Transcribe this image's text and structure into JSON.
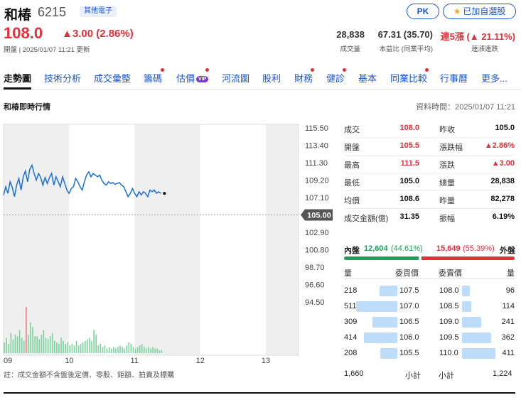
{
  "header": {
    "name": "和椿",
    "code": "6215",
    "category": "其他電子",
    "pk_label": "PK",
    "watch_label": "已加自選股"
  },
  "quote": {
    "price": "108.0",
    "change": "▲3.00 (2.86%)",
    "status": "開盤 | 2025/01/07 11:21 更新",
    "volume": "28,838",
    "volume_label": "成交量",
    "pe": "67.31 (35.70)",
    "pe_label": "本益比 (同業平均)",
    "streak": "連5漲 (▲ 21.11%)",
    "streak_label": "連漲連跌"
  },
  "tabs": [
    {
      "label": "走勢圖",
      "dot": false
    },
    {
      "label": "技術分析",
      "dot": false
    },
    {
      "label": "成交彙整",
      "dot": false
    },
    {
      "label": "籌碼",
      "dot": true
    },
    {
      "label": "估價",
      "dot": true,
      "vip": "VIP"
    },
    {
      "label": "河流圖",
      "dot": false
    },
    {
      "label": "股利",
      "dot": false
    },
    {
      "label": "財務",
      "dot": true
    },
    {
      "label": "健診",
      "dot": true
    },
    {
      "label": "基本",
      "dot": false
    },
    {
      "label": "同業比較",
      "dot": true
    },
    {
      "label": "行事曆",
      "dot": false
    },
    {
      "label": "更多...",
      "dot": false
    }
  ],
  "section": {
    "title": "和椿即時行情",
    "data_time": "資料時間：2025/01/07 11:21"
  },
  "quote_table": [
    {
      "l1": "成交",
      "v1": "108.0",
      "c1": "up",
      "l2": "昨收",
      "v2": "105.0",
      "c2": "flat"
    },
    {
      "l1": "開盤",
      "v1": "105.5",
      "c1": "up",
      "l2": "漲跌幅",
      "v2": "▲2.86%",
      "c2": "up"
    },
    {
      "l1": "最高",
      "v1": "111.5",
      "c1": "up",
      "l2": "漲跌",
      "v2": "▲3.00",
      "c2": "up"
    },
    {
      "l1": "最低",
      "v1": "105.0",
      "c1": "flat",
      "l2": "總量",
      "v2": "28,838",
      "c2": "flat"
    },
    {
      "l1": "均價",
      "v1": "108.6",
      "c1": "flat",
      "l2": "昨量",
      "v2": "82,278",
      "c2": "flat"
    },
    {
      "l1": "成交金額(億)",
      "v1": "31.35",
      "c1": "flat",
      "l2": "振幅",
      "v2": "6.19%",
      "c2": "flat"
    }
  ],
  "order_flow": {
    "inner_label": "內盤",
    "inner_value": "12,604",
    "inner_pct": "(44.61%)",
    "outer_value": "15,649",
    "outer_pct": "(55.39%)",
    "outer_label": "外盤",
    "inner_fraction": 0.4461
  },
  "order_book": {
    "col_bid_qty": "量",
    "col_bid_price": "委買價",
    "col_ask_price": "委賣價",
    "col_ask_qty": "量",
    "bids": [
      {
        "qty": "218",
        "price": "107.5",
        "q": 218
      },
      {
        "qty": "511",
        "price": "107.0",
        "q": 511
      },
      {
        "qty": "309",
        "price": "106.5",
        "q": 309
      },
      {
        "qty": "414",
        "price": "106.0",
        "q": 414
      },
      {
        "qty": "208",
        "price": "105.5",
        "q": 208
      }
    ],
    "asks": [
      {
        "qty": "96",
        "price": "108.0",
        "q": 96
      },
      {
        "qty": "114",
        "price": "108.5",
        "q": 114
      },
      {
        "qty": "241",
        "price": "109.0",
        "q": 241
      },
      {
        "qty": "362",
        "price": "109.5",
        "q": 362
      },
      {
        "qty": "411",
        "price": "110.0",
        "q": 411
      }
    ],
    "bid_total": "1,660",
    "subtotal_label": "小計",
    "ask_total": "1,224"
  },
  "note": "註：成交金額不含盤後定價、零股、鉅額、拍賣及標購",
  "chart_data": {
    "type": "line",
    "y_ticks": [
      "115.50",
      "113.40",
      "111.30",
      "109.20",
      "107.10",
      "105.00",
      "102.90",
      "100.80",
      "98.70",
      "96.60",
      "94.50"
    ],
    "x_ticks": [
      "09",
      "10",
      "11",
      "12",
      "13"
    ],
    "ref_price": 105.0,
    "ylim": [
      94.5,
      115.5
    ],
    "x_range_minutes": [
      0,
      270
    ],
    "colors": {
      "line": "#1a6fd6",
      "volume": "#7ad39c",
      "volume_up": "#e77b7b",
      "ref": "#999999"
    },
    "series": [
      {
        "values": [
          [
            0,
            107.4
          ],
          [
            2,
            108.4
          ],
          [
            4,
            107.6
          ],
          [
            6,
            109.0
          ],
          [
            8,
            108.3
          ],
          [
            10,
            107.2
          ],
          [
            12,
            108.6
          ],
          [
            14,
            109.4
          ],
          [
            16,
            108.0
          ],
          [
            18,
            109.6
          ],
          [
            20,
            110.3
          ],
          [
            22,
            109.0
          ],
          [
            24,
            110.5
          ],
          [
            26,
            111.0
          ],
          [
            28,
            110.0
          ],
          [
            30,
            109.2
          ],
          [
            32,
            110.0
          ],
          [
            34,
            109.5
          ],
          [
            36,
            108.6
          ],
          [
            38,
            109.5
          ],
          [
            40,
            108.8
          ],
          [
            42,
            109.5
          ],
          [
            44,
            110.0
          ],
          [
            46,
            108.6
          ],
          [
            48,
            109.6
          ],
          [
            50,
            109.0
          ],
          [
            52,
            108.4
          ],
          [
            54,
            109.6
          ],
          [
            56,
            108.8
          ],
          [
            58,
            108.0
          ],
          [
            60,
            107.6
          ],
          [
            62,
            108.2
          ],
          [
            64,
            108.4
          ],
          [
            66,
            109.4
          ],
          [
            68,
            109.0
          ],
          [
            70,
            108.4
          ],
          [
            72,
            108.0
          ],
          [
            74,
            109.0
          ],
          [
            76,
            109.8
          ],
          [
            78,
            110.2
          ],
          [
            80,
            109.6
          ],
          [
            82,
            110.0
          ],
          [
            84,
            109.8
          ],
          [
            86,
            109.6
          ],
          [
            88,
            109.8
          ],
          [
            90,
            109.2
          ],
          [
            92,
            108.8
          ],
          [
            94,
            108.6
          ],
          [
            96,
            109.0
          ],
          [
            98,
            108.8
          ],
          [
            100,
            108.9
          ],
          [
            102,
            108.7
          ],
          [
            104,
            108.8
          ],
          [
            106,
            108.9
          ],
          [
            108,
            108.6
          ],
          [
            110,
            108.4
          ],
          [
            112,
            107.8
          ],
          [
            114,
            107.2
          ],
          [
            116,
            107.6
          ],
          [
            118,
            108.2
          ],
          [
            120,
            107.6
          ],
          [
            122,
            107.2
          ],
          [
            124,
            107.8
          ],
          [
            126,
            107.4
          ],
          [
            128,
            107.8
          ],
          [
            130,
            107.6
          ],
          [
            132,
            107.2
          ],
          [
            134,
            108.0
          ],
          [
            136,
            107.8
          ],
          [
            138,
            108.0
          ],
          [
            140,
            107.6
          ],
          [
            142,
            107.8
          ],
          [
            144,
            107.6
          ]
        ]
      }
    ],
    "volume": [
      [
        0,
        14,
        0
      ],
      [
        2,
        20,
        0
      ],
      [
        4,
        12,
        0
      ],
      [
        6,
        26,
        0
      ],
      [
        8,
        18,
        0
      ],
      [
        10,
        24,
        0
      ],
      [
        12,
        22,
        0
      ],
      [
        14,
        30,
        0
      ],
      [
        16,
        20,
        0
      ],
      [
        18,
        16,
        0
      ],
      [
        20,
        60,
        1
      ],
      [
        22,
        24,
        0
      ],
      [
        24,
        40,
        0
      ],
      [
        26,
        34,
        0
      ],
      [
        28,
        22,
        0
      ],
      [
        30,
        22,
        0
      ],
      [
        32,
        18,
        0
      ],
      [
        34,
        24,
        0
      ],
      [
        36,
        30,
        0
      ],
      [
        38,
        20,
        0
      ],
      [
        40,
        18,
        0
      ],
      [
        42,
        22,
        0
      ],
      [
        44,
        26,
        0
      ],
      [
        46,
        16,
        0
      ],
      [
        48,
        14,
        0
      ],
      [
        50,
        12,
        0
      ],
      [
        52,
        20,
        0
      ],
      [
        54,
        16,
        0
      ],
      [
        56,
        12,
        0
      ],
      [
        58,
        14,
        0
      ],
      [
        60,
        10,
        0
      ],
      [
        62,
        12,
        0
      ],
      [
        64,
        10,
        0
      ],
      [
        66,
        16,
        0
      ],
      [
        68,
        10,
        0
      ],
      [
        70,
        12,
        0
      ],
      [
        72,
        14,
        0
      ],
      [
        74,
        16,
        0
      ],
      [
        76,
        18,
        0
      ],
      [
        78,
        20,
        0
      ],
      [
        80,
        16,
        0
      ],
      [
        82,
        30,
        0
      ],
      [
        84,
        24,
        0
      ],
      [
        86,
        10,
        0
      ],
      [
        88,
        12,
        0
      ],
      [
        90,
        8,
        0
      ],
      [
        92,
        10,
        0
      ],
      [
        94,
        6,
        0
      ],
      [
        96,
        8,
        0
      ],
      [
        98,
        6,
        0
      ],
      [
        100,
        8,
        0
      ],
      [
        102,
        6,
        0
      ],
      [
        104,
        8,
        0
      ],
      [
        106,
        10,
        0
      ],
      [
        108,
        8,
        0
      ],
      [
        110,
        6,
        0
      ],
      [
        112,
        10,
        0
      ],
      [
        114,
        14,
        0
      ],
      [
        116,
        12,
        0
      ],
      [
        118,
        8,
        0
      ],
      [
        120,
        6,
        0
      ],
      [
        122,
        8,
        0
      ],
      [
        124,
        10,
        0
      ],
      [
        126,
        12,
        0
      ],
      [
        128,
        8,
        0
      ],
      [
        130,
        6,
        0
      ],
      [
        132,
        8,
        0
      ],
      [
        134,
        6,
        0
      ],
      [
        136,
        8,
        0
      ],
      [
        138,
        6,
        0
      ],
      [
        140,
        6,
        0
      ],
      [
        142,
        4,
        0
      ],
      [
        144,
        4,
        0
      ]
    ]
  }
}
